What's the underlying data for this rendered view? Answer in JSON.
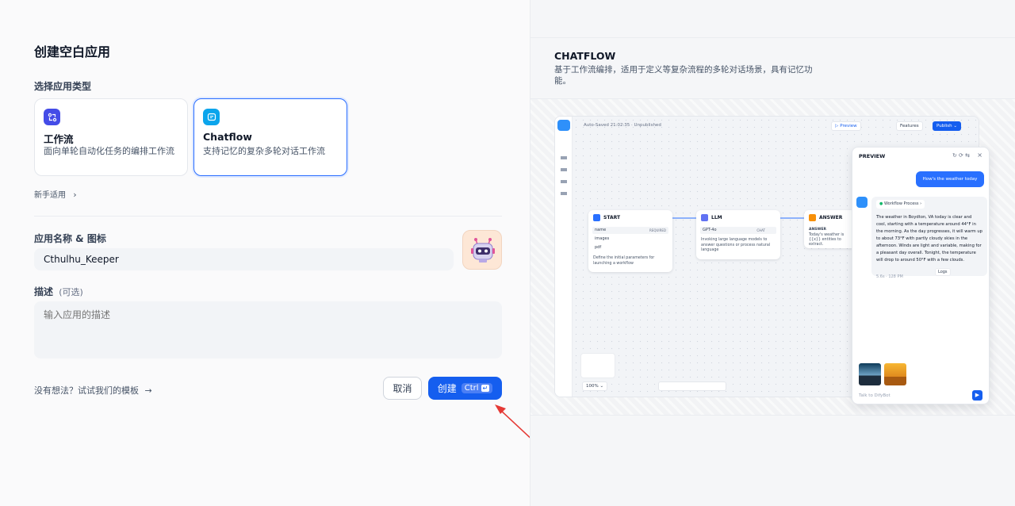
{
  "dialog": {
    "title": "创建空白应用",
    "type_section_label": "选择应用类型",
    "app_types": [
      {
        "name": "工作流",
        "description": "面向单轮自动化任务的编排工作流",
        "icon": "workflow-icon",
        "color": "#444ce7"
      },
      {
        "name": "Chatflow",
        "description": "支持记忆的复杂多轮对话工作流",
        "icon": "chatflow-icon",
        "color": "#0ba5ec"
      }
    ],
    "selected_type": "Chatflow",
    "beginner_link": "新手适用",
    "name_icon_label": "应用名称 & 图标",
    "name_value": "Cthulhu_Keeper",
    "description_label": "描述",
    "description_optional": "(可选)",
    "description_placeholder": "输入应用的描述",
    "no_idea_link": "没有想法？试试我们的模板",
    "cancel_label": "取消",
    "create_label": "创建",
    "create_shortcut": "Ctrl",
    "accent_color": "#155eef"
  },
  "preview": {
    "title": "CHATFLOW",
    "description": "基于工作流编排，适用于定义等复杂流程的多轮对话场景，具有记忆功能。",
    "editor": {
      "status": "Auto-Saved 21:02:35 · Unpublished",
      "toolbar": {
        "preview": "Preview",
        "features": "Features",
        "publish": "Publish"
      },
      "zoom": "100%",
      "nodes": {
        "start": {
          "title": "START",
          "fields": [
            "name",
            "images",
            "pdf"
          ],
          "required_tag": "REQUIRED",
          "description": "Define the initial parameters for launching a workflow"
        },
        "llm": {
          "title": "LLM",
          "model": "GPT-4o",
          "mode": "CHAT",
          "description": "Invoking large language models to answer questions or process natural language"
        },
        "answer": {
          "title": "ANSWER",
          "label": "ANSWER",
          "text": "Today's weather is {{x}} entities to extract."
        }
      }
    },
    "chat_panel": {
      "title": "PREVIEW",
      "user_message": "How's the weather today",
      "workflow_process": "Workflow Process",
      "bot_reply": "The weather in Boydton, VA today is clear and cool, starting with a temperature around 44°F in the morning. As the day progresses, it will warm up to about 73°F with partly cloudy skies in the afternoon. Winds are light and variable, making for a pleasant day overall. Tonight, the temperature will drop to around 50°F with a few clouds.",
      "meta": "5.6s · 128 PM",
      "logs": "Logs",
      "input_placeholder": "Talk to DifyBot"
    }
  }
}
